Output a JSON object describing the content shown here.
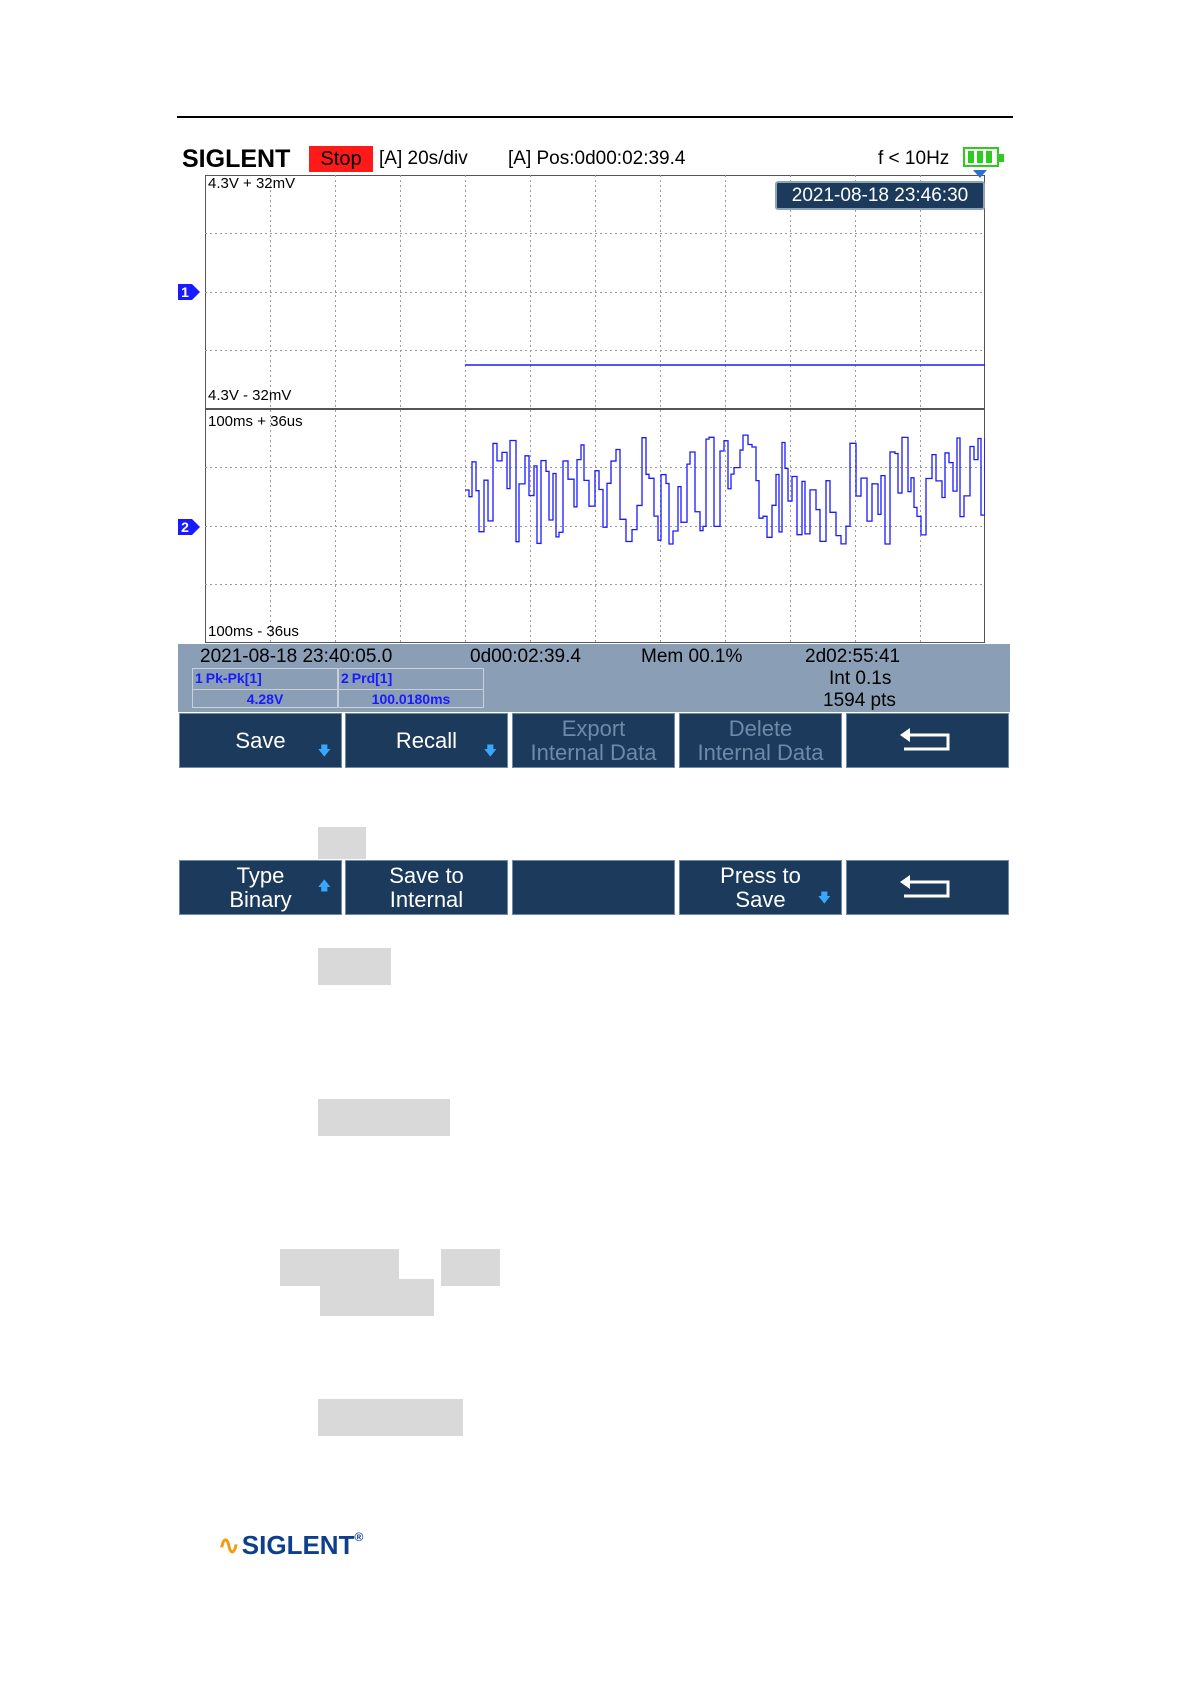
{
  "status_bar": {
    "brand": "SIGLENT",
    "run_state": "Stop",
    "timebase": "[A] 20s/div",
    "position": "[A] Pos:0d00:02:39.4",
    "frequency": "f < 10Hz"
  },
  "screen": {
    "datetime": "2021-08-18 23:46:30",
    "ch1_top": "4.3V + 32mV",
    "ch1_bottom": "4.3V - 32mV",
    "ch2_top": "100ms + 36us",
    "ch2_bottom": "100ms - 36us",
    "ch1_marker": "1",
    "ch2_marker": "2"
  },
  "info_panel": {
    "start_time": "2021-08-18 23:40:05.0",
    "elapsed": "0d00:02:39.4",
    "memory": "Mem 00.1%",
    "duration": "2d02:55:41",
    "interval": "Int 0.1s",
    "points": "1594 pts",
    "measurements": [
      {
        "channel": "1",
        "name": "Pk-Pk[1]",
        "value": "4.28V"
      },
      {
        "channel": "2",
        "name": "Prd[1]",
        "value": "100.0180ms"
      }
    ]
  },
  "menu1": {
    "keys": [
      {
        "label": "Save"
      },
      {
        "label": "Recall"
      },
      {
        "line1": "Export",
        "line2": "Internal Data"
      },
      {
        "line1": "Delete",
        "line2": "Internal Data"
      },
      {
        "label": "back"
      }
    ]
  },
  "menu2": {
    "keys": [
      {
        "line1": "Type",
        "line2": "Binary"
      },
      {
        "line1": "Save to",
        "line2": "Internal"
      },
      {
        "label": ""
      },
      {
        "line1": "Press to",
        "line2": "Save"
      },
      {
        "label": "back"
      }
    ]
  },
  "footer": {
    "logo": "SIGLENT",
    "registered": "®"
  },
  "colors": {
    "trace": "#1a1aff",
    "panel": "#1c3a5c",
    "info_bg": "#8a9fb6",
    "stop": "#ff1a1a",
    "battery": "#2ecc1f"
  }
}
